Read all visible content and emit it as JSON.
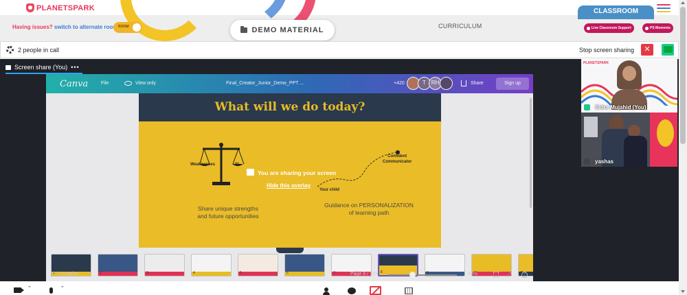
{
  "header": {
    "logo_text": "PLANETSPARK",
    "issues_text": "Having issues?",
    "alternate_link": "switch to alternate room",
    "toggle_label": "ROOM",
    "demo_material": "DEMO MATERIAL",
    "curriculum": "CURRICULUM",
    "classroom_tab": "CLASSROOM",
    "support_pill": "Live Classroom Support",
    "moments_pill": "PS Moments"
  },
  "callbar": {
    "people_count": "2 people in call",
    "stop_sharing": "Stop screen sharing",
    "close_symbol": "✕"
  },
  "share_tab": {
    "label": "Screen share (You)",
    "menu": "•••"
  },
  "canva": {
    "logo": "Canva",
    "file_menu": "File",
    "view_mode": "View only",
    "doc_title": "Final_Creator_Junior_Demo_PPT ...",
    "viewer_count": "+420",
    "avatars": [
      "",
      "T",
      "RH",
      ""
    ],
    "share": "Share",
    "signup": "Sign up",
    "slide": {
      "title": "What will we do today?",
      "weaknesses": "Weaknesses",
      "strengths_short": "St",
      "confident": "Confident\nCommunicator",
      "your_child": "Your child",
      "strengths_text": "Share unique strengths\nand future opportunities",
      "guidance_text": "Guidance on PERSONALIZATION\nof learning path"
    },
    "thumbnail_numbers": [
      "1",
      "2",
      "3",
      "4",
      "5",
      "6",
      "7",
      "8",
      "9",
      "10",
      "11"
    ],
    "duration": "Duration",
    "page_indicator": "Page 8 / 123",
    "zoom": "44%",
    "help": "?",
    "zoom_level": 0.35
  },
  "overlay": {
    "message": "You are sharing your screen",
    "hide_link": "Hide this overlay"
  },
  "participants": [
    {
      "name": "Sidra Mujahid (You)"
    },
    {
      "name": "yashas"
    }
  ],
  "tile_logo": "PLANETSPARK",
  "bottombar": {
    "chevron": "⌃"
  },
  "colors": {
    "brand_red": "#e8345a",
    "link_blue": "#3a7bd5",
    "classroom_blue": "#4a90c6",
    "pill_magenta": "#c2185b",
    "stop_red": "#e53946",
    "slide_yellow": "#f5c427",
    "slide_navy": "#2b3a4e",
    "workspace_dark": "#1f2228"
  }
}
